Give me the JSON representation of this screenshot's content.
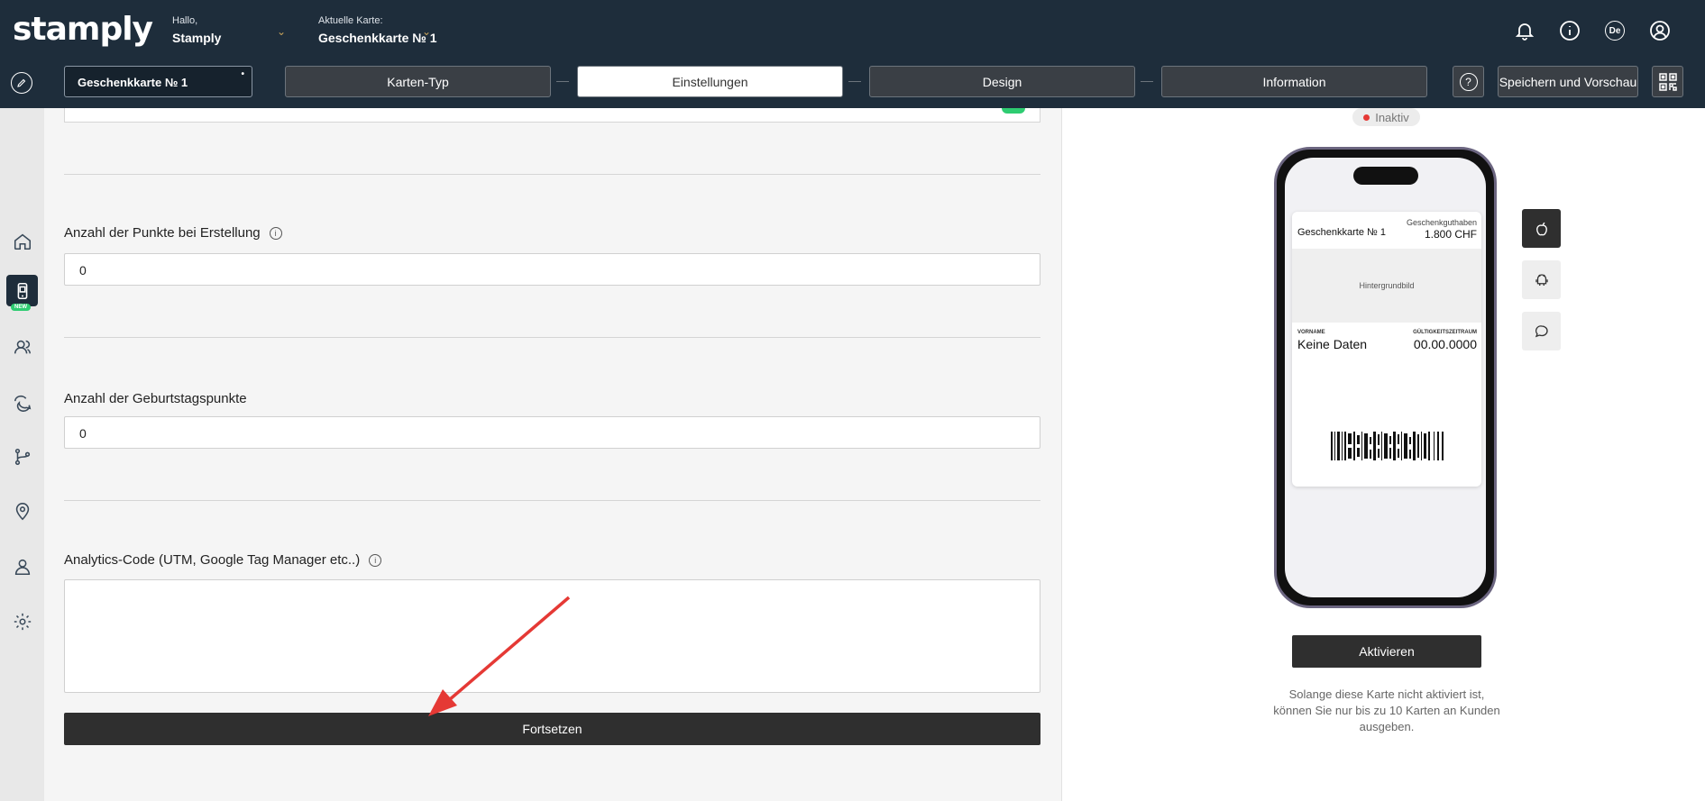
{
  "header": {
    "logo": "stamply",
    "greeting_label": "Hallo,",
    "greeting_name": "Stamply",
    "current_card_label": "Aktuelle Karte:",
    "current_card_name": "Geschenkkarte № 1",
    "language_badge": "De"
  },
  "toolbar": {
    "card_name_value": "Geschenkkarte № 1",
    "steps": [
      {
        "label": "Karten-Typ",
        "active": false
      },
      {
        "label": "Einstellungen",
        "active": true
      },
      {
        "label": "Design",
        "active": false
      },
      {
        "label": "Information",
        "active": false
      }
    ],
    "help_label": "?",
    "save_label": "Speichern und Vorschau"
  },
  "sidebar": {
    "items": [
      {
        "icon": "home-icon"
      },
      {
        "icon": "card-phone-icon",
        "badge": "NEW",
        "active": true
      },
      {
        "icon": "users-icon"
      },
      {
        "icon": "chat-icon"
      },
      {
        "icon": "flow-icon"
      },
      {
        "icon": "location-icon"
      },
      {
        "icon": "user-settings-icon"
      },
      {
        "icon": "gear-icon"
      }
    ]
  },
  "form": {
    "fields": [
      {
        "label": "Anzahl der Punkte bei Erstellung",
        "value": "0",
        "has_info": true
      },
      {
        "label": "Anzahl der Geburtstagspunkte",
        "value": "0",
        "has_info": false
      }
    ],
    "analytics_label": "Analytics-Code (UTM, Google Tag Manager etc..)",
    "analytics_value": "",
    "continue_label": "Fortsetzen"
  },
  "preview": {
    "status": "Inaktiv",
    "status_color": "#e53935",
    "pass": {
      "title": "Geschenkkarte № 1",
      "balance_label": "Geschenkguthaben",
      "balance_value": "1.800 CHF",
      "background_label": "Hintergrundbild",
      "left_field_label": "VORNAME",
      "left_field_value": "Keine Daten",
      "right_field_label": "GÜLTIGKEITSZEITRAUM",
      "right_field_value": "00.00.0000"
    },
    "activate_label": "Aktivieren",
    "activate_note": "Solange diese Karte nicht aktiviert ist, können Sie nur bis zu 10 Karten an Kunden ausgeben."
  },
  "colors": {
    "header_bg": "#1e2d3b",
    "accent_green": "#2ecc71",
    "annotation_arrow": "#e53935"
  }
}
